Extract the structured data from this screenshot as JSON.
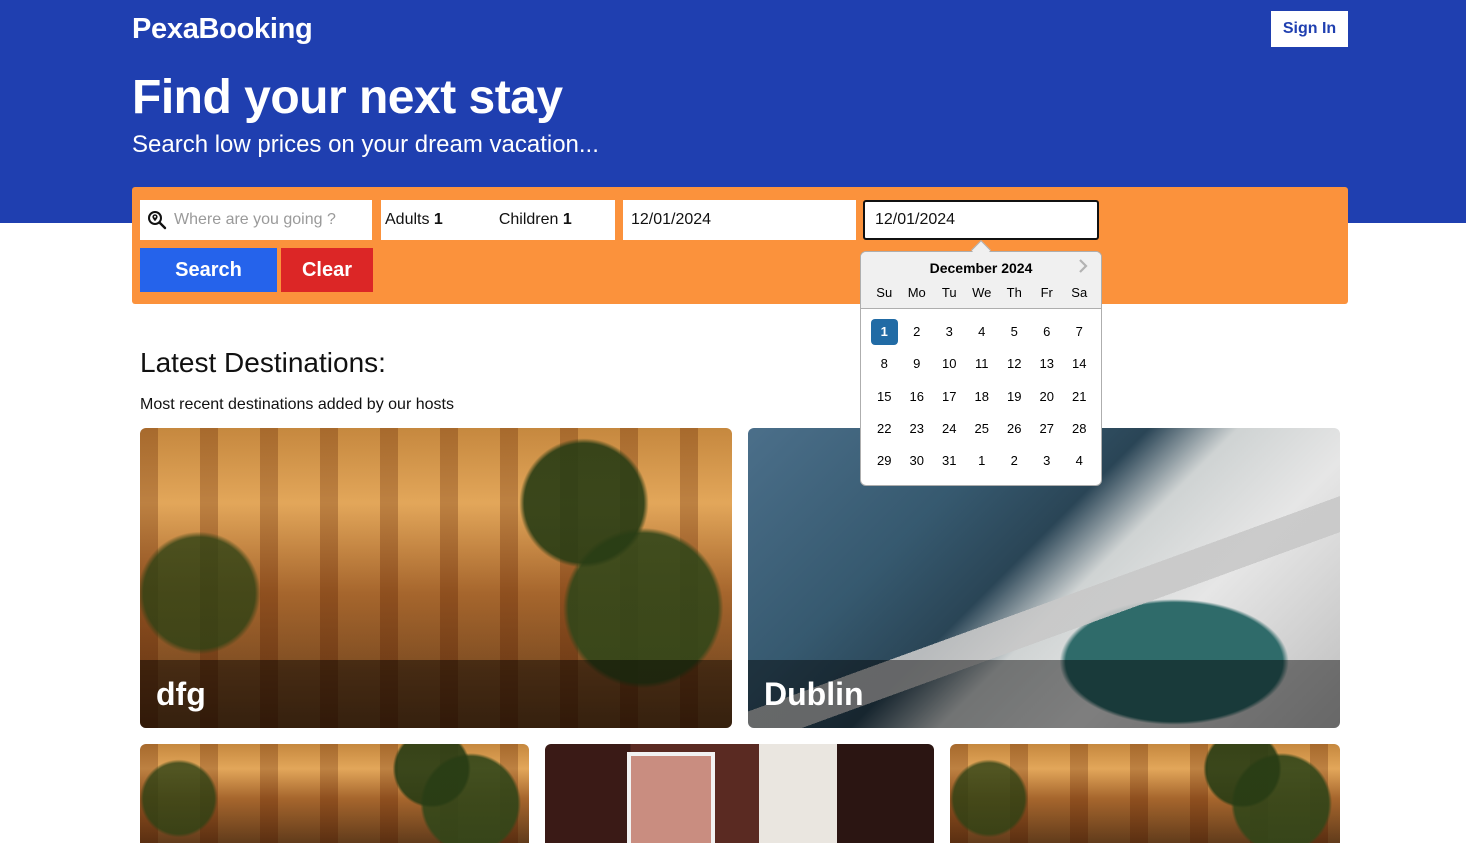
{
  "header": {
    "logo": "PexaBooking",
    "sign_in_label": "Sign In",
    "title": "Find your next stay",
    "subtitle": "Search low prices on your dream vacation..."
  },
  "search": {
    "destination_placeholder": "Where are you going ?",
    "adults_label": "Adults",
    "adults_value": "1",
    "children_label": "Children",
    "children_value": "1",
    "check_in": "12/01/2024",
    "check_out": "12/01/2024",
    "search_label": "Search",
    "clear_label": "Clear",
    "colors": {
      "bar": "#fb923c",
      "search": "#2563eb",
      "clear": "#dc2626"
    }
  },
  "calendar": {
    "month_label": "December 2024",
    "next_icon": "chevron-right-icon",
    "weekdays": [
      "Su",
      "Mo",
      "Tu",
      "We",
      "Th",
      "Fr",
      "Sa"
    ],
    "weeks": [
      [
        "1",
        "2",
        "3",
        "4",
        "5",
        "6",
        "7"
      ],
      [
        "8",
        "9",
        "10",
        "11",
        "12",
        "13",
        "14"
      ],
      [
        "15",
        "16",
        "17",
        "18",
        "19",
        "20",
        "21"
      ],
      [
        "22",
        "23",
        "24",
        "25",
        "26",
        "27",
        "28"
      ],
      [
        "29",
        "30",
        "31",
        "1",
        "2",
        "3",
        "4"
      ]
    ],
    "selected_day": "1"
  },
  "latest": {
    "title": "Latest Destinations:",
    "subtitle": "Most recent destinations added by our hosts",
    "cards": [
      {
        "name": "dfg"
      },
      {
        "name": "Dublin"
      }
    ]
  },
  "theme": {
    "brand": "#1f3fb0"
  }
}
